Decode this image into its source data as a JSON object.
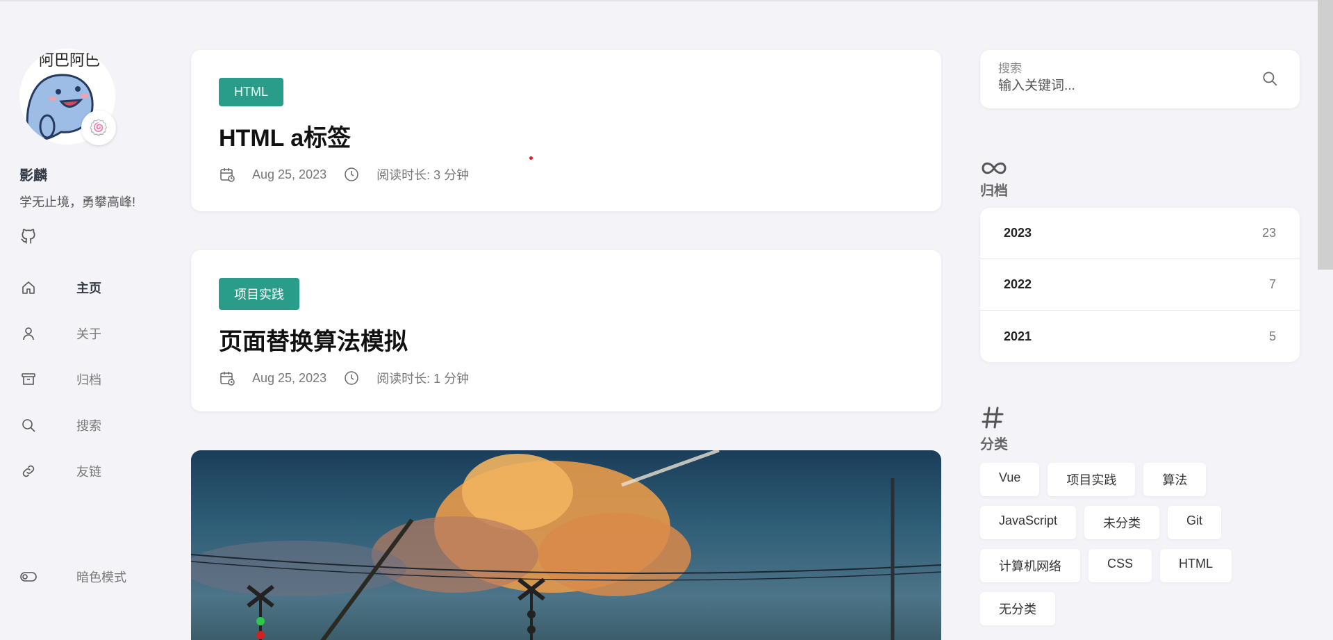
{
  "author": {
    "name": "影麟",
    "bio": "学无止境，勇攀高峰!",
    "avatar_text": "阿巴阿巴",
    "badge_emoji": "🍥"
  },
  "nav": {
    "items": [
      {
        "label": "主页",
        "icon": "home-icon",
        "active": true
      },
      {
        "label": "关于",
        "icon": "user-icon",
        "active": false
      },
      {
        "label": "归档",
        "icon": "archive-icon",
        "active": false
      },
      {
        "label": "搜索",
        "icon": "search-icon",
        "active": false
      },
      {
        "label": "友链",
        "icon": "link-icon",
        "active": false
      }
    ],
    "dark_mode_label": "暗色模式"
  },
  "posts": [
    {
      "tag": "HTML",
      "title": "HTML a标签",
      "date": "Aug 25, 2023",
      "reading": "阅读时长: 3 分钟"
    },
    {
      "tag": "项目实践",
      "title": "页面替换算法模拟",
      "date": "Aug 25, 2023",
      "reading": "阅读时长: 1 分钟"
    }
  ],
  "search": {
    "label": "搜索",
    "placeholder": "输入关键词..."
  },
  "archive": {
    "title": "归档",
    "years": [
      {
        "year": "2023",
        "count": "23"
      },
      {
        "year": "2022",
        "count": "7"
      },
      {
        "year": "2021",
        "count": "5"
      }
    ]
  },
  "categories": {
    "title": "分类",
    "tags": [
      "Vue",
      "项目实践",
      "算法",
      "JavaScript",
      "未分类",
      "Git",
      "计算机网络",
      "CSS",
      "HTML",
      "无分类"
    ]
  },
  "colors": {
    "accent": "#2a9d8a",
    "background": "#f4f4f8"
  }
}
